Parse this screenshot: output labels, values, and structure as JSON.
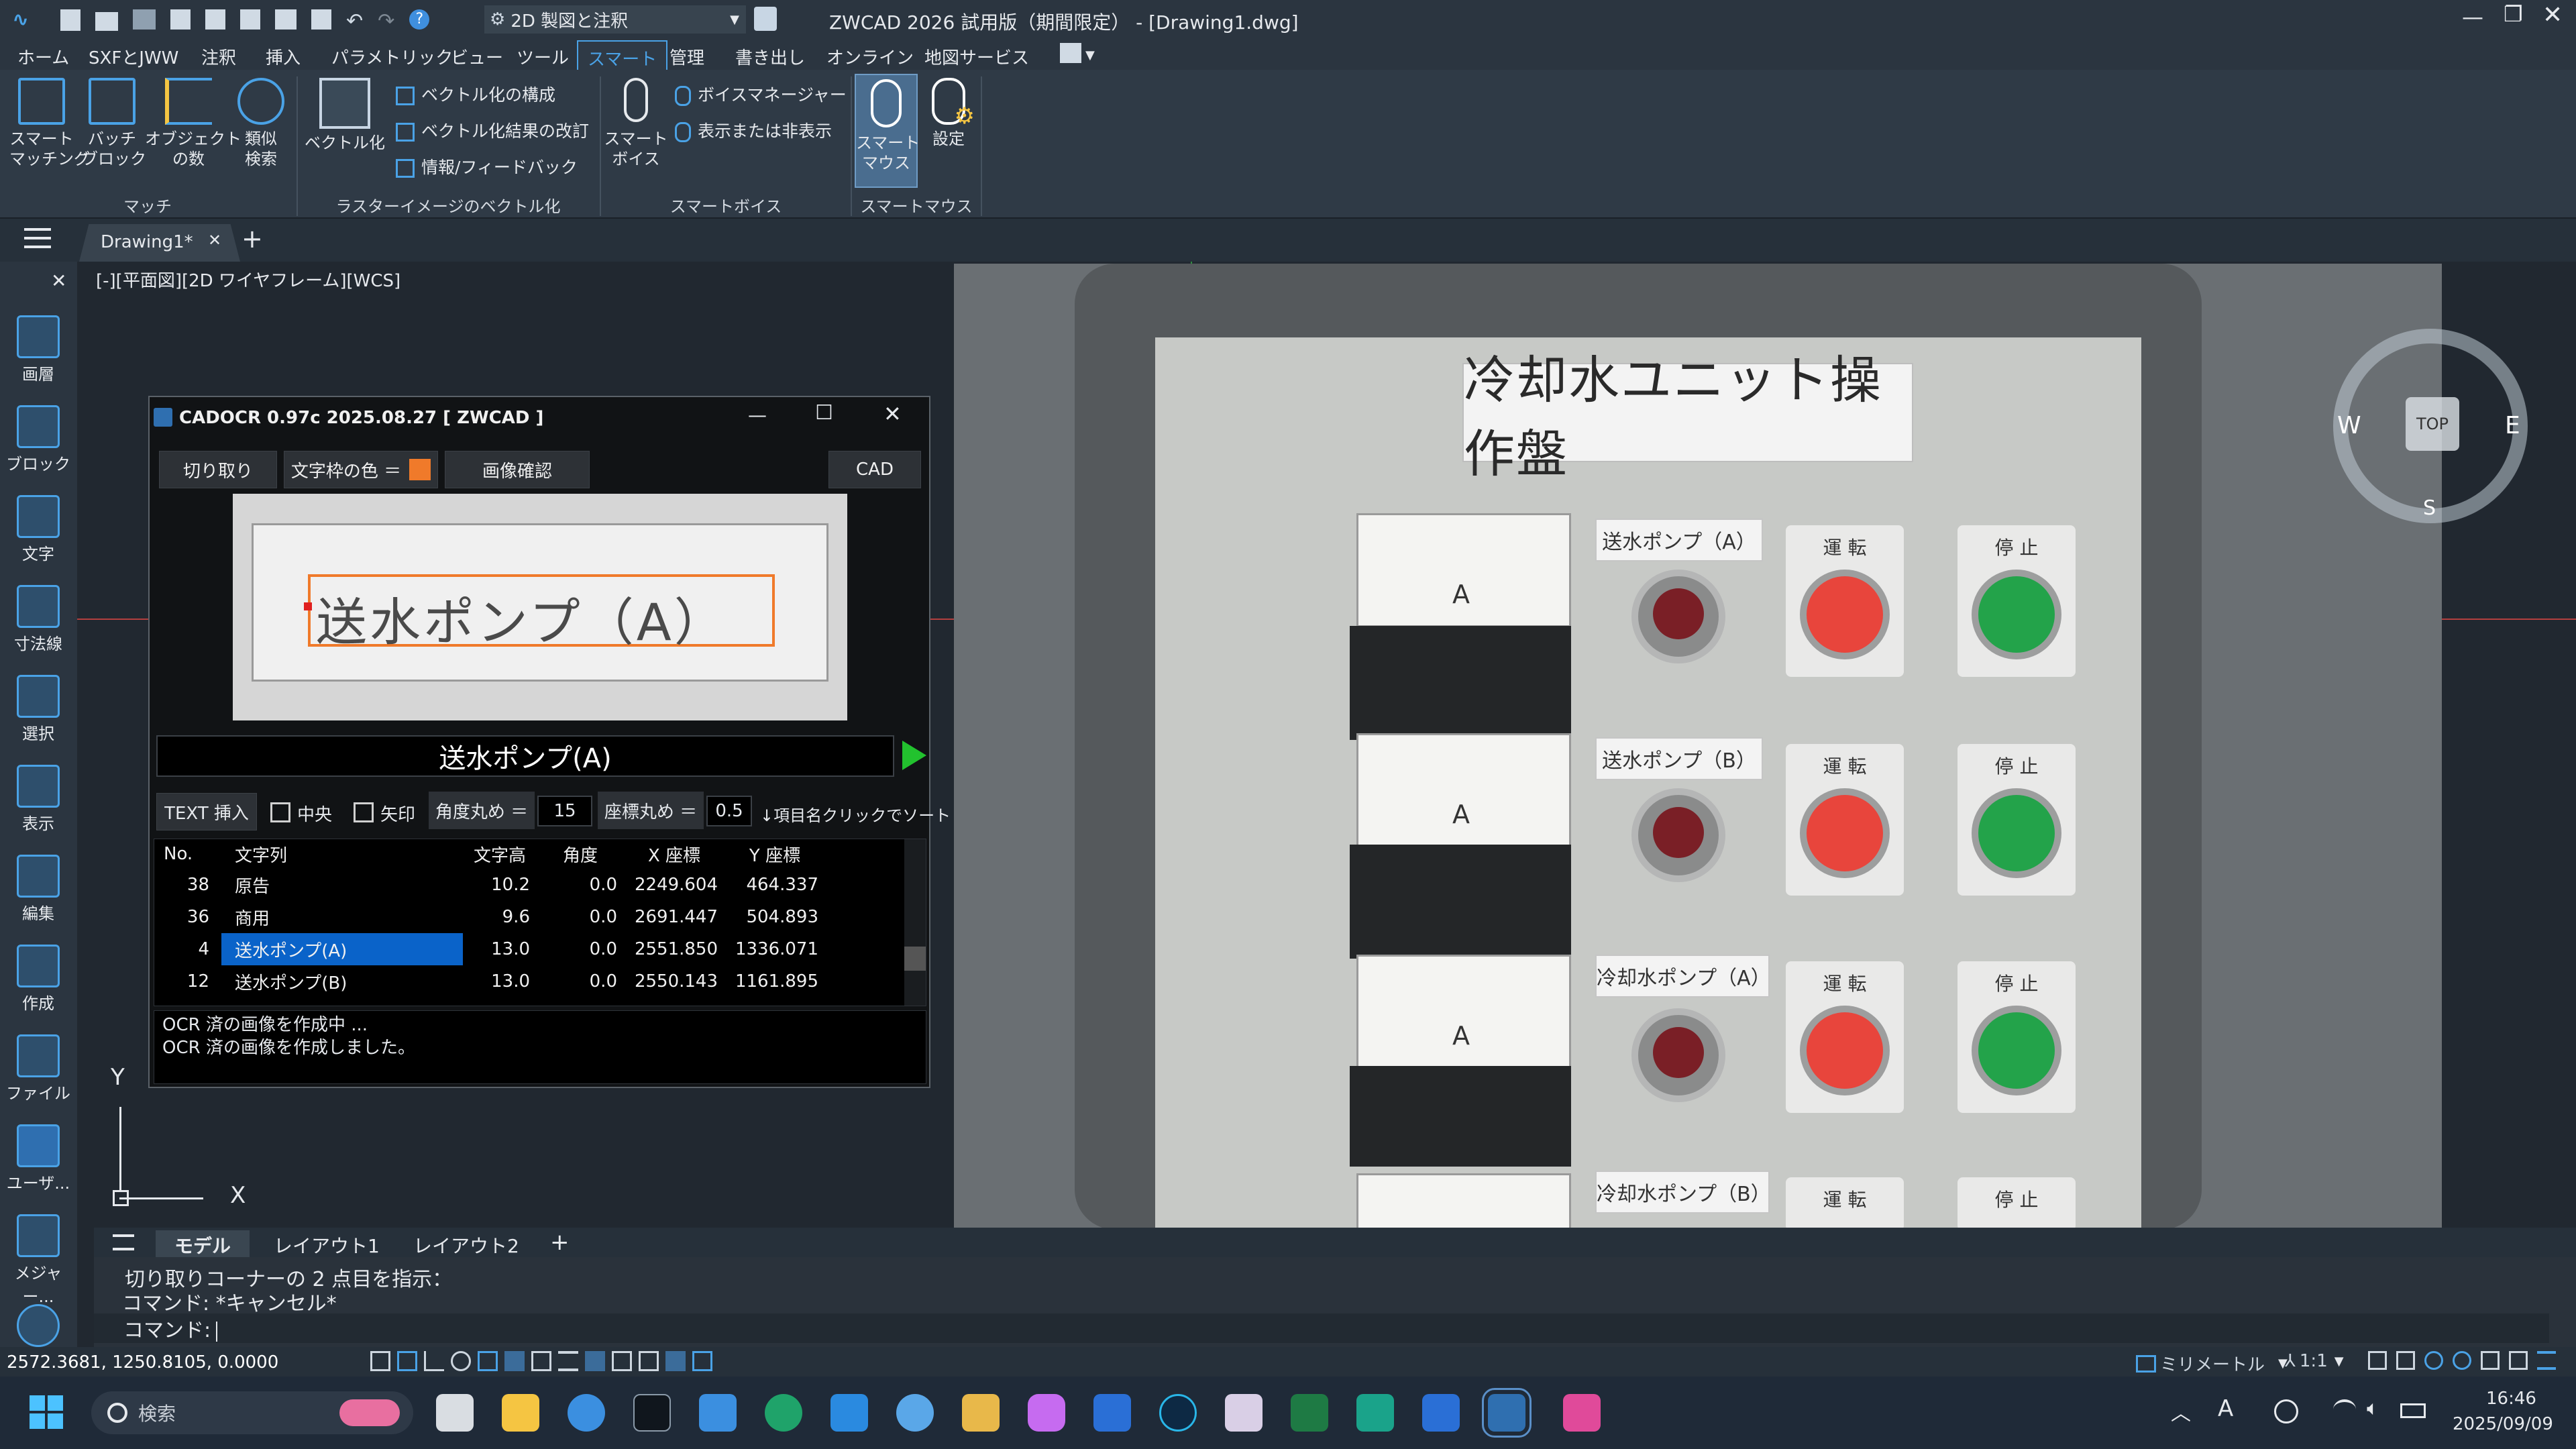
{
  "title_bar": {
    "workspace": "2D 製図と注釈",
    "window_title": "ZWCAD 2026 試用版（期間限定） - [Drawing1.dwg]"
  },
  "menu_tabs": [
    "ホーム",
    "SXFとJWW",
    "注釈",
    "挿入",
    "パラメトリック",
    "ビュー",
    "ツール",
    "スマート",
    "管理",
    "書き出し",
    "オンライン",
    "地図サービス"
  ],
  "active_tab": "スマート",
  "ribbon": {
    "match": {
      "smart_matching": "スマート\nマッチング",
      "batch_block": "バッチ\nブロック",
      "object_count": "オブジェクト\nの数",
      "similar_search": "類似\n検索",
      "group": "マッチ"
    },
    "raster": {
      "vectorize": "ベクトル化",
      "vec_config": "ベクトル化の構成",
      "vec_fix": "ベクトル化結果の改訂",
      "info_feedback": "情報/フィードバック",
      "group": "ラスターイメージのベクトル化"
    },
    "voice": {
      "smart_voice": "スマート\nボイス",
      "voice_manager": "ボイスマネージャー",
      "show_hide": "表示または非表示",
      "group": "スマートボイス"
    },
    "mouse": {
      "smart_mouse": "スマート\nマウス",
      "settings": "設定",
      "group": "スマートマウス"
    }
  },
  "doc_tab": "Drawing1*",
  "viewport_label": "[-][平面図][2D ワイヤフレーム][WCS]",
  "left_tools": [
    "画層",
    "ブロック",
    "文字",
    "寸法線",
    "選択",
    "表示",
    "編集",
    "作成",
    "ファイル",
    "ユーザ...",
    "メジャー..."
  ],
  "dialog": {
    "title": "CADOCR 0.97c 2025.08.27 [ ZWCAD ]",
    "btn_crop": "切り取り",
    "btn_color": "文字枠の色 ＝",
    "btn_check": "画像確認",
    "btn_cad": "CAD",
    "frame_color": "#f07a2a",
    "preview_text": "送水ポンプ（A）",
    "ocr_result": "送水ポンプ(A)",
    "btn_insert": "TEXT 挿入",
    "chk_center": "中央",
    "chk_arrow": "矢印",
    "angle_round_label": "角度丸め ＝",
    "angle_round": "15",
    "coord_round_label": "座標丸め ＝",
    "coord_round": "0.5",
    "sort_hint": "↓項目名クリックでソート",
    "columns": [
      "No.",
      "文字列",
      "文字高",
      "角度",
      "X 座標",
      "Y 座標"
    ],
    "rows": [
      [
        "38",
        "原告",
        "10.2",
        "0.0",
        "2249.604",
        "464.337"
      ],
      [
        "36",
        "商用",
        "9.6",
        "0.0",
        "2691.447",
        "504.893"
      ],
      [
        "4",
        "送水ポンプ(A)",
        "13.0",
        "0.0",
        "2551.850",
        "1336.071"
      ],
      [
        "12",
        "送水ポンプ(B)",
        "13.0",
        "0.0",
        "2550.143",
        "1161.895"
      ]
    ],
    "selected_row": 2,
    "log": [
      "OCR 済の画像を作成中 ...",
      "OCR 済の画像を作成しました。"
    ]
  },
  "photo": {
    "panel_title": "冷却水ユニット操作盤",
    "labels": [
      "送水ポンプ（A）",
      "送水ポンプ（B）",
      "冷却水ポンプ（A）",
      "冷却水ポンプ（B）"
    ],
    "run": "運 転",
    "stop": "停 止",
    "meter_unit": "A"
  },
  "viewcube": {
    "top": "TOP",
    "w": "W",
    "e": "E",
    "s": "S"
  },
  "layout_tabs": [
    "モデル",
    "レイアウト1",
    "レイアウト2"
  ],
  "command": {
    "line1": "切り取りコーナーの 2 点目を指示：",
    "line2": "コマンド: *キャンセル*",
    "prompt": "コマンド:"
  },
  "status": {
    "coords": "2572.3681, 1250.8105, 0.0000",
    "units": "ミリメートル",
    "scale": "1:1"
  },
  "taskbar": {
    "search": "検索",
    "time": "16:46",
    "date": "2025/09/09",
    "ime": "A"
  },
  "axis": {
    "x": "X",
    "y": "Y"
  }
}
